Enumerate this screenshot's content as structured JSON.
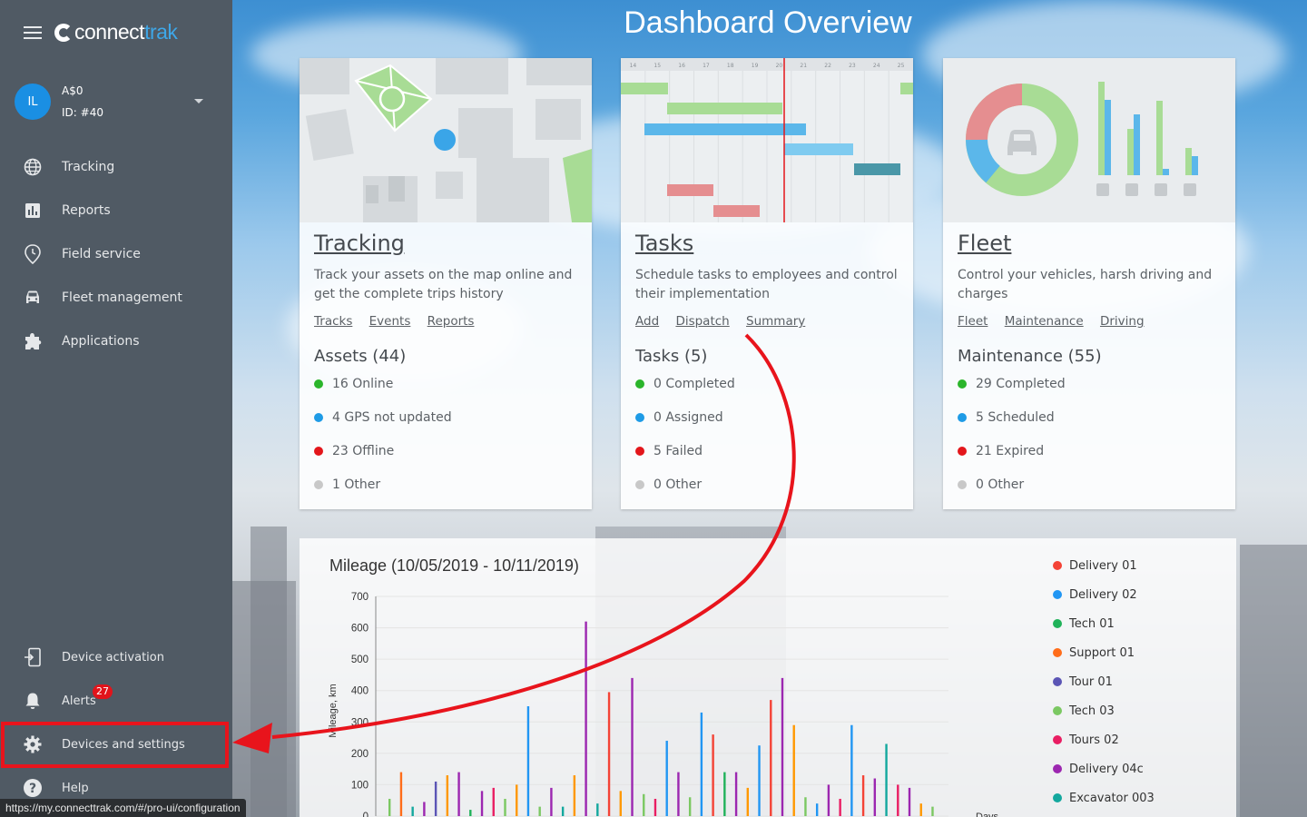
{
  "app": {
    "logo_main": "connect",
    "logo_accent": "trak"
  },
  "account": {
    "initials": "IL",
    "name": "A$0",
    "id": "ID: #40"
  },
  "nav": {
    "tracking": "Tracking",
    "reports": "Reports",
    "field_service": "Field service",
    "fleet_management": "Fleet management",
    "applications": "Applications",
    "device_activation": "Device activation",
    "alerts": "Alerts",
    "alerts_count": "27",
    "devices_settings": "Devices and settings",
    "help": "Help"
  },
  "status_url": "https://my.connecttrak.com/#/pro-ui/configuration",
  "page_title": "Dashboard Overview",
  "cards": {
    "tracking": {
      "title": "Tracking",
      "desc": "Track your assets on the map online and get the complete trips history",
      "links": [
        "Tracks",
        "Events",
        "Reports"
      ],
      "heading": "Assets (44)",
      "stats": [
        "16 Online",
        "4 GPS not updated",
        "23 Offline",
        "1 Other"
      ]
    },
    "tasks": {
      "title": "Tasks",
      "desc": "Schedule tasks to employees and control their implementation",
      "links": [
        "Add",
        "Dispatch",
        "Summary"
      ],
      "heading": "Tasks (5)",
      "stats": [
        "0 Completed",
        "0 Assigned",
        "5 Failed",
        "0 Other"
      ],
      "gantt_days": [
        "14",
        "15",
        "16",
        "17",
        "18",
        "19",
        "20",
        "21",
        "22",
        "23",
        "24",
        "25"
      ]
    },
    "fleet": {
      "title": "Fleet",
      "desc": "Control your vehicles, harsh driving and charges",
      "links": [
        "Fleet",
        "Maintenance",
        "Driving"
      ],
      "heading": "Maintenance (55)",
      "stats": [
        "29 Completed",
        "5 Scheduled",
        "21 Expired",
        "0 Other"
      ]
    }
  },
  "stat_colors": [
    "#2bb52b",
    "#1e9be6",
    "#e3161b",
    "#c8c8c8"
  ],
  "chart_data": {
    "type": "bar",
    "title": "Mileage (10/05/2019 - 10/11/2019)",
    "ylabel": "Mileage, km",
    "xlabel": "Days",
    "ylim": [
      0,
      700
    ],
    "yticks": [
      "700",
      "600",
      "500",
      "400",
      "300",
      "200",
      "100",
      "0"
    ],
    "series": [
      {
        "name": "Delivery 01",
        "color": "#f44336"
      },
      {
        "name": "Delivery 02",
        "color": "#2196f3"
      },
      {
        "name": "Tech 01",
        "color": "#20b25a"
      },
      {
        "name": "Support 01",
        "color": "#ff6d1a"
      },
      {
        "name": "Tour 01",
        "color": "#5b55b5"
      },
      {
        "name": "Tech 03",
        "color": "#7bc862"
      },
      {
        "name": "Tours 02",
        "color": "#e91e63"
      },
      {
        "name": "Delivery 04c",
        "color": "#9c27b0"
      },
      {
        "name": "Excavator 003",
        "color": "#13a89e"
      }
    ],
    "bars": [
      {
        "c": "#7bc862",
        "v": 55
      },
      {
        "c": "#ff6d1a",
        "v": 140
      },
      {
        "c": "#13a89e",
        "v": 30
      },
      {
        "c": "#9c27b0",
        "v": 45
      },
      {
        "c": "#5b55b5",
        "v": 110
      },
      {
        "c": "#ff9800",
        "v": 130
      },
      {
        "c": "#9c27b0",
        "v": 140
      },
      {
        "c": "#20b25a",
        "v": 20
      },
      {
        "c": "#9c27b0",
        "v": 80
      },
      {
        "c": "#e91e63",
        "v": 90
      },
      {
        "c": "#7bc862",
        "v": 55
      },
      {
        "c": "#ff9800",
        "v": 100
      },
      {
        "c": "#2196f3",
        "v": 350
      },
      {
        "c": "#7bc862",
        "v": 30
      },
      {
        "c": "#9c27b0",
        "v": 90
      },
      {
        "c": "#13a89e",
        "v": 30
      },
      {
        "c": "#ff9800",
        "v": 130
      },
      {
        "c": "#9c27b0",
        "v": 620
      },
      {
        "c": "#13a89e",
        "v": 40
      },
      {
        "c": "#f44336",
        "v": 395
      },
      {
        "c": "#ff9800",
        "v": 80
      },
      {
        "c": "#9c27b0",
        "v": 440
      },
      {
        "c": "#7bc862",
        "v": 70
      },
      {
        "c": "#e91e63",
        "v": 55
      },
      {
        "c": "#2196f3",
        "v": 240
      },
      {
        "c": "#9c27b0",
        "v": 140
      },
      {
        "c": "#7bc862",
        "v": 60
      },
      {
        "c": "#2196f3",
        "v": 330
      },
      {
        "c": "#f44336",
        "v": 260
      },
      {
        "c": "#20b25a",
        "v": 140
      },
      {
        "c": "#9c27b0",
        "v": 140
      },
      {
        "c": "#ff9800",
        "v": 90
      },
      {
        "c": "#2196f3",
        "v": 225
      },
      {
        "c": "#f44336",
        "v": 370
      },
      {
        "c": "#9c27b0",
        "v": 440
      },
      {
        "c": "#ff9800",
        "v": 290
      },
      {
        "c": "#7bc862",
        "v": 60
      },
      {
        "c": "#2196f3",
        "v": 40
      },
      {
        "c": "#9c27b0",
        "v": 100
      },
      {
        "c": "#e91e63",
        "v": 55
      },
      {
        "c": "#2196f3",
        "v": 290
      },
      {
        "c": "#f44336",
        "v": 130
      },
      {
        "c": "#9c27b0",
        "v": 120
      },
      {
        "c": "#13a89e",
        "v": 230
      },
      {
        "c": "#e91e63",
        "v": 100
      },
      {
        "c": "#9c27b0",
        "v": 90
      },
      {
        "c": "#ff9800",
        "v": 40
      },
      {
        "c": "#7bc862",
        "v": 30
      }
    ]
  }
}
